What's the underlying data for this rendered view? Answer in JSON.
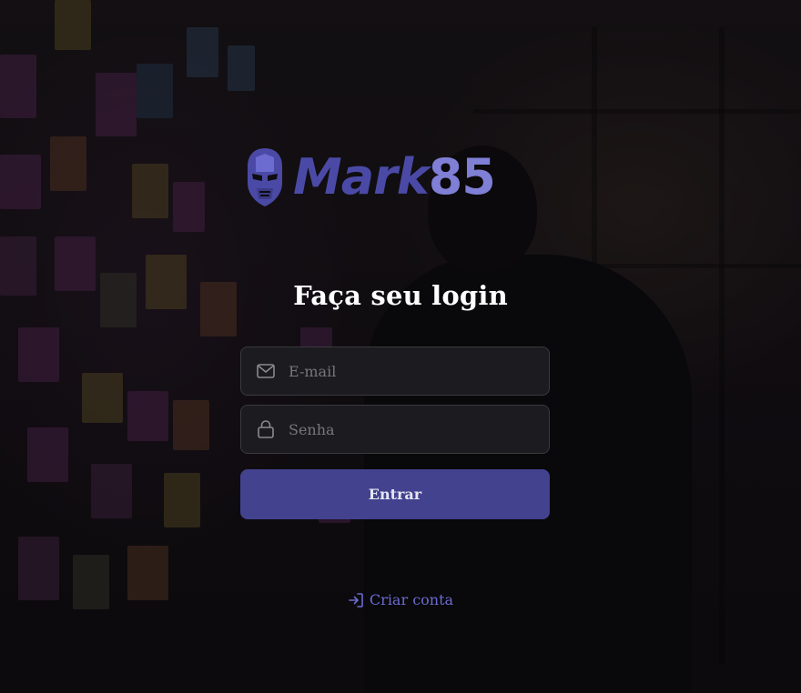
{
  "brand": {
    "logo_text_primary": "Mark",
    "logo_text_secondary": "85",
    "logo_icon": "iron-helmet-icon",
    "color_primary": "#4a4aa6",
    "color_secondary": "#7f7fd6"
  },
  "login": {
    "title": "Faça seu login",
    "email": {
      "placeholder": "E-mail",
      "value": "",
      "icon": "mail-icon"
    },
    "password": {
      "placeholder": "Senha",
      "value": "",
      "icon": "lock-icon"
    },
    "submit_label": "Entrar",
    "submit_color": "#42428f"
  },
  "signup": {
    "label": "Criar conta",
    "icon": "log-in-icon",
    "color": "#6b6bd0"
  }
}
